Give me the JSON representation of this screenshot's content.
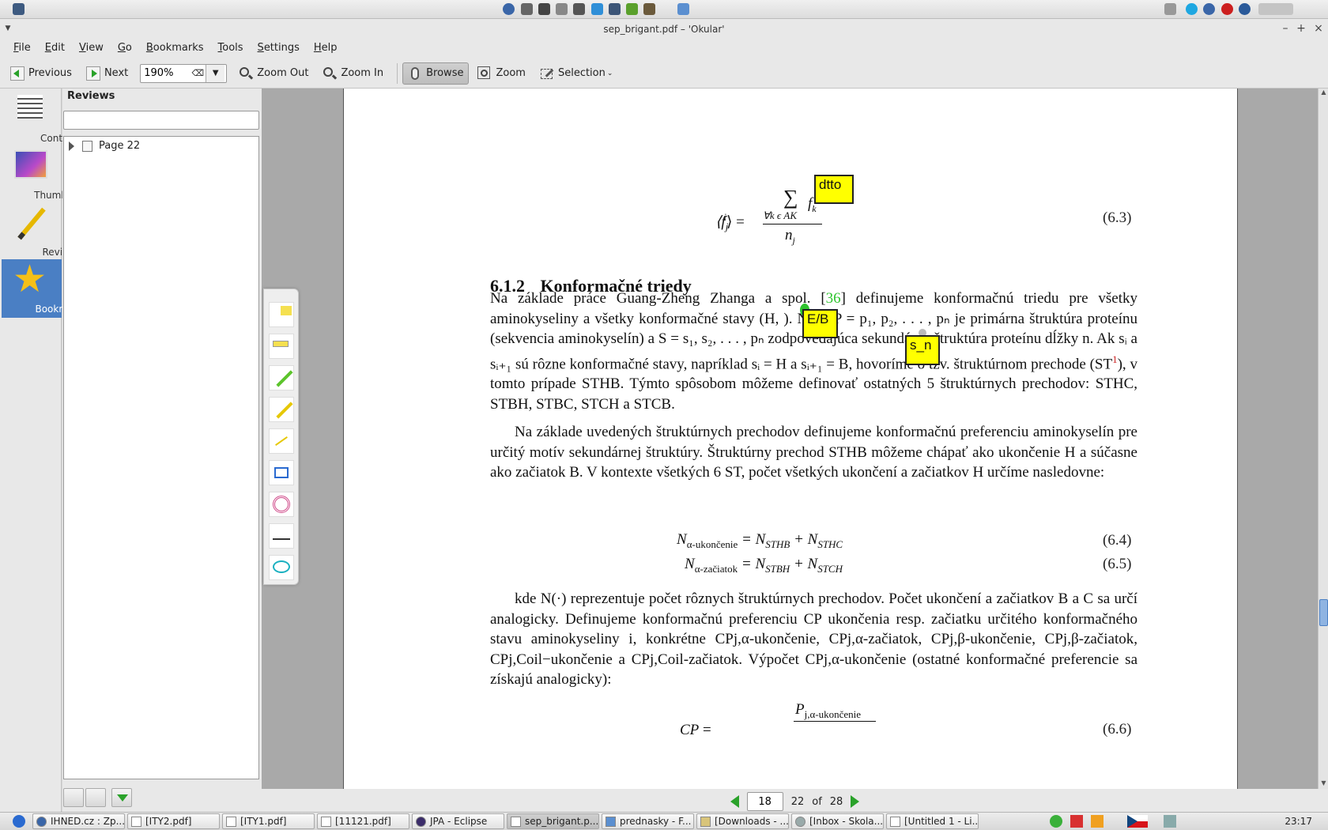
{
  "window": {
    "title": "sep_brigant.pdf – 'Okular'"
  },
  "menu": [
    "File",
    "Edit",
    "View",
    "Go",
    "Bookmarks",
    "Tools",
    "Settings",
    "Help"
  ],
  "toolbar": {
    "previous": "Previous",
    "next": "Next",
    "zoom_value": "190%",
    "zoom_out": "Zoom Out",
    "zoom_in": "Zoom In",
    "browse": "Browse",
    "zoom": "Zoom",
    "selection": "Selection"
  },
  "side_tabs": [
    "Contents",
    "Thumbnails",
    "Reviews",
    "Bookmarks"
  ],
  "reviews": {
    "title": "Reviews",
    "search_value": "",
    "tree_item": "Page 22"
  },
  "document": {
    "eq63_lhs": "⟨f",
    "eq63_sub": "j",
    "eq63_sup": "i",
    "eq63_sum_index": "∀k ϵ AK",
    "eq63_den": "n",
    "eq63_den_sub": "j",
    "eq63_num_f": "f",
    "eq63_num_sub": "k",
    "eq63_number": "(6.3)",
    "section_number": "6.1.2",
    "section_title": "Konformačné triedy",
    "p1_a": "Na základe práce Guang-Zheng Zhanga a spol. [",
    "p1_cite": "36",
    "p1_b": "] definujeme konformačnú triedu pre všetky aminokyseliny a všetky konformačné stavy (H, ",
    "p1_c": "). Nech P = p₁, p₂, . . . , pₙ je primárna štruktúra proteínu (sekvencia aminokyselín) a S = s₁, s₂, . . . , pₙ zodpovedajúca sekundárna štruktúra proteínu dĺžky n. Ak sᵢ a sᵢ₊₁ sú rôzne konformačné stavy, napríklad sᵢ = H a sᵢ₊₁ = B, hovoríme o tzv. štruktúrnom prechode (ST",
    "p1_fn": "1",
    "p1_d": "), v tomto prípade ST",
    "p1_e": "HB. Týmto spôsobom môžeme definovať ostatných 5 štruktúrnych prechodov: STHC, STBH, STBC, STCH a STCB.",
    "p2": "Na základe uvedených štruktúrnych prechodov definujeme konformačnú preferenciu aminokyselín pre určitý motív sekundárnej štruktúry. Štruktúrny prechod STHB môžeme chápať ako ukončenie H a súčasne ako začiatok B. V kontexte všetkých 6 ST, počet všetkých ukončení a začiatkov H určíme nasledovne:",
    "eq64_lhs": "N",
    "eq64_lhs_sub": "α-ukončenie",
    "eq64_rhs": "= N",
    "eq64_r1": "STHB",
    "eq64_plus": " + N",
    "eq64_r2": "STHC",
    "eq64_number": "(6.4)",
    "eq65_lhs": "N",
    "eq65_lhs_sub": "α-začiatok",
    "eq65_rhs": "= N",
    "eq65_r1": "STBH",
    "eq65_plus": " + N",
    "eq65_r2": "STCH",
    "eq65_number": "(6.5)",
    "p3": "kde N(·) reprezentuje počet rôznych štruktúrnych prechodov. Počet ukončení a začiatkov B a C sa určí analogicky. Definujeme konformačnú preferenciu CP ukončenia resp. začiatku určitého konformačného stavu aminokyseliny i, konkrétne CPj,α-ukončenie, CPj,α-začiatok, CPj,β-ukončenie, CPj,β-začiatok, CPj,Coil−ukončenie a CPj,Coil-začiatok. Výpočet CPj,α-ukončenie (ostatné konformačné preferencie sa získajú analogicky):",
    "eq66_lhs": "CP",
    "eq66_num": "P",
    "eq66_num_sub": "j,α-ukončenie",
    "eq66_number": "(6.6)"
  },
  "notes": [
    {
      "text": "dtto"
    },
    {
      "text": "E/B"
    },
    {
      "text": "s_n"
    }
  ],
  "pagenav": {
    "current": "18",
    "page_label": "22",
    "of": "of",
    "total": "28"
  },
  "taskbar": {
    "tasks": [
      "IHNED.cz : Zp...",
      "[ITY2.pdf]",
      "[ITY1.pdf]",
      "[11121.pdf]",
      "JPA - Eclipse",
      "sep_brigant.p...",
      "prednasky - F...",
      "[Downloads - ...",
      "[Inbox - Skola...",
      "[Untitled 1 - Li..."
    ],
    "clock": "23:17"
  },
  "colors": {
    "accent": "#4a7fc4",
    "note_yellow": "#ffff00",
    "cite_green": "#2ec42e",
    "nav_green": "#2aa22a"
  }
}
